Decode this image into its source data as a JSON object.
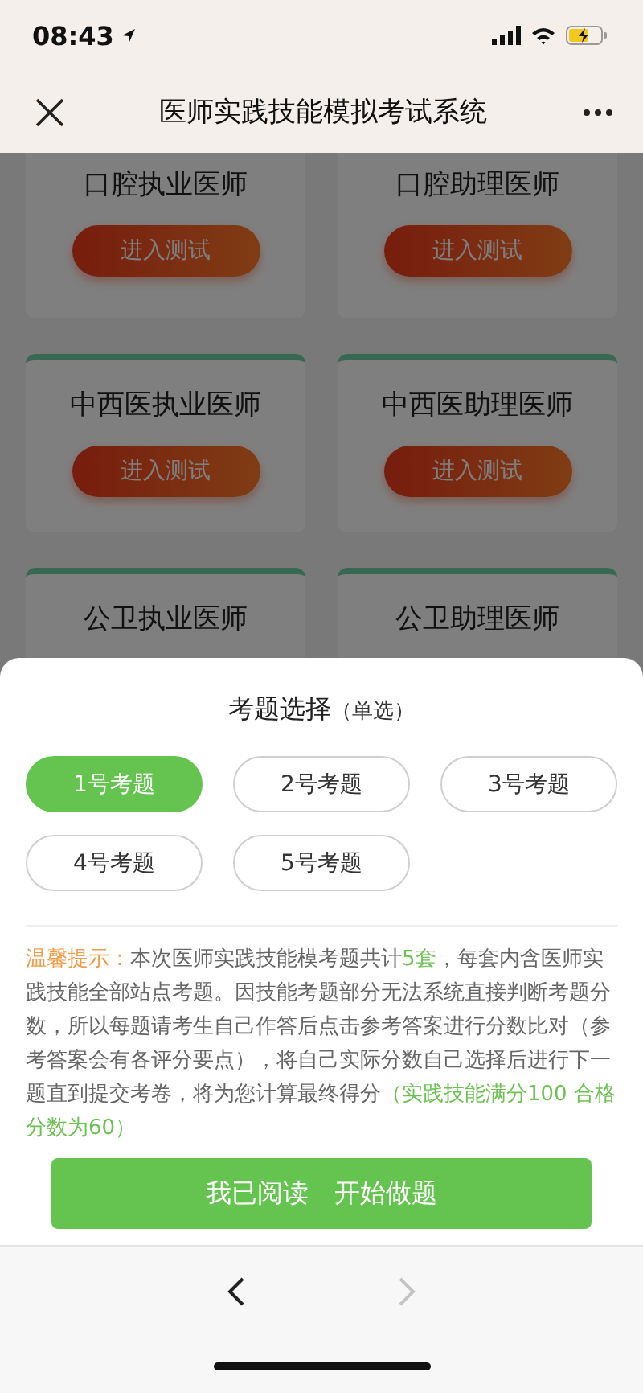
{
  "status_bar": {
    "time": "08:43"
  },
  "nav": {
    "title": "医师实践技能模拟考试系统"
  },
  "cards": [
    {
      "title": "口腔执业医师",
      "button": "进入测试"
    },
    {
      "title": "口腔助理医师",
      "button": "进入测试"
    },
    {
      "title": "中西医执业医师",
      "button": "进入测试"
    },
    {
      "title": "中西医助理医师",
      "button": "进入测试"
    },
    {
      "title": "公卫执业医师"
    },
    {
      "title": "公卫助理医师"
    }
  ],
  "sheet": {
    "title": "考题选择",
    "subtitle": "（单选）",
    "options": [
      {
        "label": "1号考题",
        "selected": true
      },
      {
        "label": "2号考题",
        "selected": false
      },
      {
        "label": "3号考题",
        "selected": false
      },
      {
        "label": "4号考题",
        "selected": false
      },
      {
        "label": "5号考题",
        "selected": false
      }
    ],
    "notice": [
      {
        "kind": "label",
        "text": "温馨提示："
      },
      {
        "kind": "normal",
        "text": "本次医师实践技能模考题共计"
      },
      {
        "kind": "highlight",
        "text": "5套"
      },
      {
        "kind": "normal",
        "text": "，每套内含医师实践技能全部站点考题。因技能考题部分无法系统直接判断考题分数，所以每题请考生自己作答后点击参考答案进行分数比对（参考答案会有各评分要点），将自己实际分数自己选择后进行下一题直到提交考卷，将为您计算最终得分"
      },
      {
        "kind": "highlight",
        "text": "（实践技能满分100 合格分数为60）"
      }
    ],
    "confirm_button": "我已阅读　开始做题"
  },
  "toolbar": {
    "back": {
      "disabled": false
    },
    "forward": {
      "disabled": true
    }
  }
}
